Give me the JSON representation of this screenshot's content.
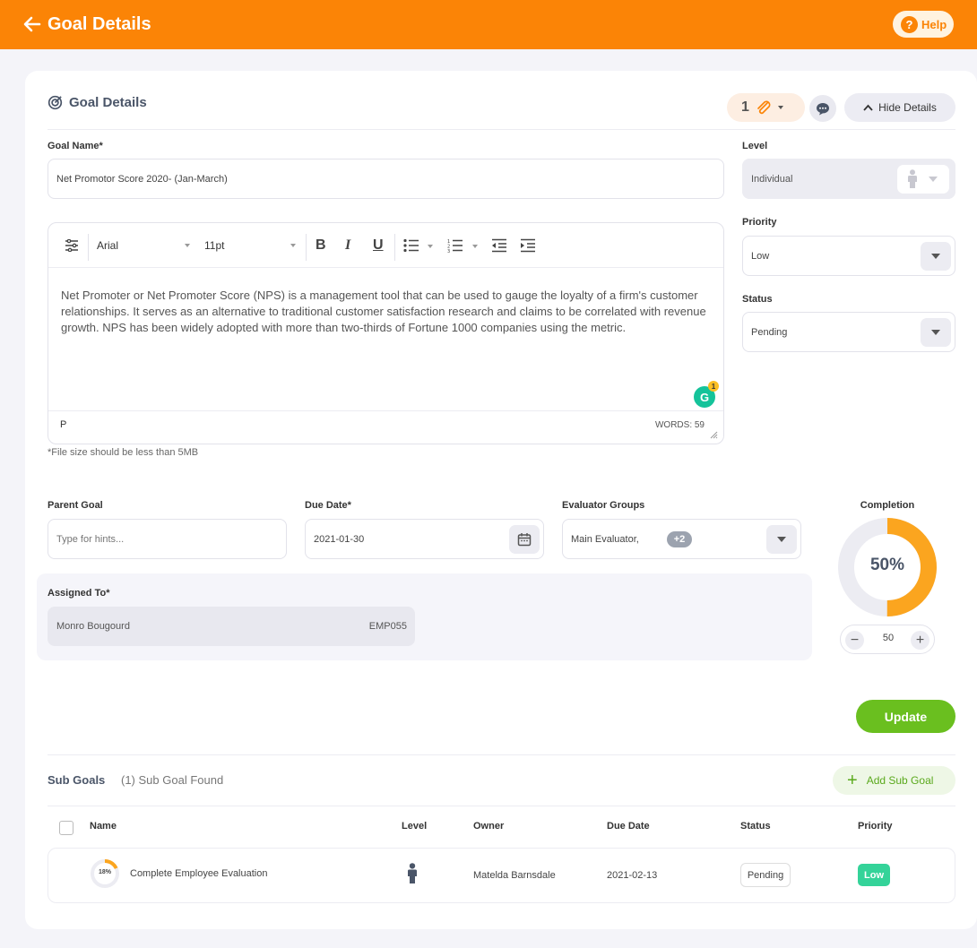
{
  "topbar": {
    "title": "Goal Details",
    "help_label": "Help",
    "help_icon": "?"
  },
  "section": {
    "title": "Goal Details"
  },
  "actions": {
    "attachment_count": "1",
    "hide_label": "Hide Details"
  },
  "goal_name": {
    "label": "Goal Name*",
    "value": "Net Promotor Score 2020- (Jan-March)"
  },
  "editor": {
    "font": "Arial",
    "size": "11pt",
    "bold": "B",
    "italic": "I",
    "underline": "U",
    "content": "Net Promoter or Net Promoter Score (NPS) is a management tool that can be used to gauge the loyalty of a firm's customer relationships. It serves as an alternative to traditional customer satisfaction research and claims to be correlated with revenue growth. NPS has been widely adopted with more than two-thirds of Fortune 1000 companies using the metric.",
    "path": "P",
    "word_count": "WORDS: 59",
    "grammarly_letter": "G",
    "grammarly_badge": "1"
  },
  "file_note": "*File size should be less than 5MB",
  "level": {
    "label": "Level",
    "value": "Individual"
  },
  "priority": {
    "label": "Priority",
    "value": "Low"
  },
  "status": {
    "label": "Status",
    "value": "Pending"
  },
  "parent_goal": {
    "label": "Parent Goal",
    "placeholder": "Type for hints..."
  },
  "due_date": {
    "label": "Due Date*",
    "value": "2021-01-30"
  },
  "evaluator_groups": {
    "label": "Evaluator Groups",
    "value": "Main Evaluator,",
    "extra": "+2"
  },
  "assigned_to": {
    "label": "Assigned To*",
    "name": "Monro Bougourd",
    "emp_id": "EMP055"
  },
  "completion": {
    "label": "Completion",
    "percent_text": "50%",
    "value": 50,
    "stepper_value": "50",
    "minus": "−",
    "plus": "+",
    "accent": "#fba51f",
    "track": "#ececf2"
  },
  "update_label": "Update",
  "sub_goals": {
    "title": "Sub Goals",
    "count_text": "(1) Sub Goal Found",
    "add_label": "Add Sub Goal",
    "add_icon": "+",
    "columns": {
      "name": "Name",
      "level": "Level",
      "owner": "Owner",
      "due_date": "Due Date",
      "status": "Status",
      "priority": "Priority"
    },
    "rows": [
      {
        "progress_text": "18%",
        "progress": 18,
        "name": "Complete Employee Evaluation",
        "level_icon": "person-icon",
        "owner": "Matelda Barnsdale",
        "due_date": "2021-02-13",
        "status": "Pending",
        "priority": "Low"
      }
    ]
  },
  "colors": {
    "topbar": "#fb8406",
    "update": "#6abf1f",
    "priority_low": "#34d399"
  }
}
